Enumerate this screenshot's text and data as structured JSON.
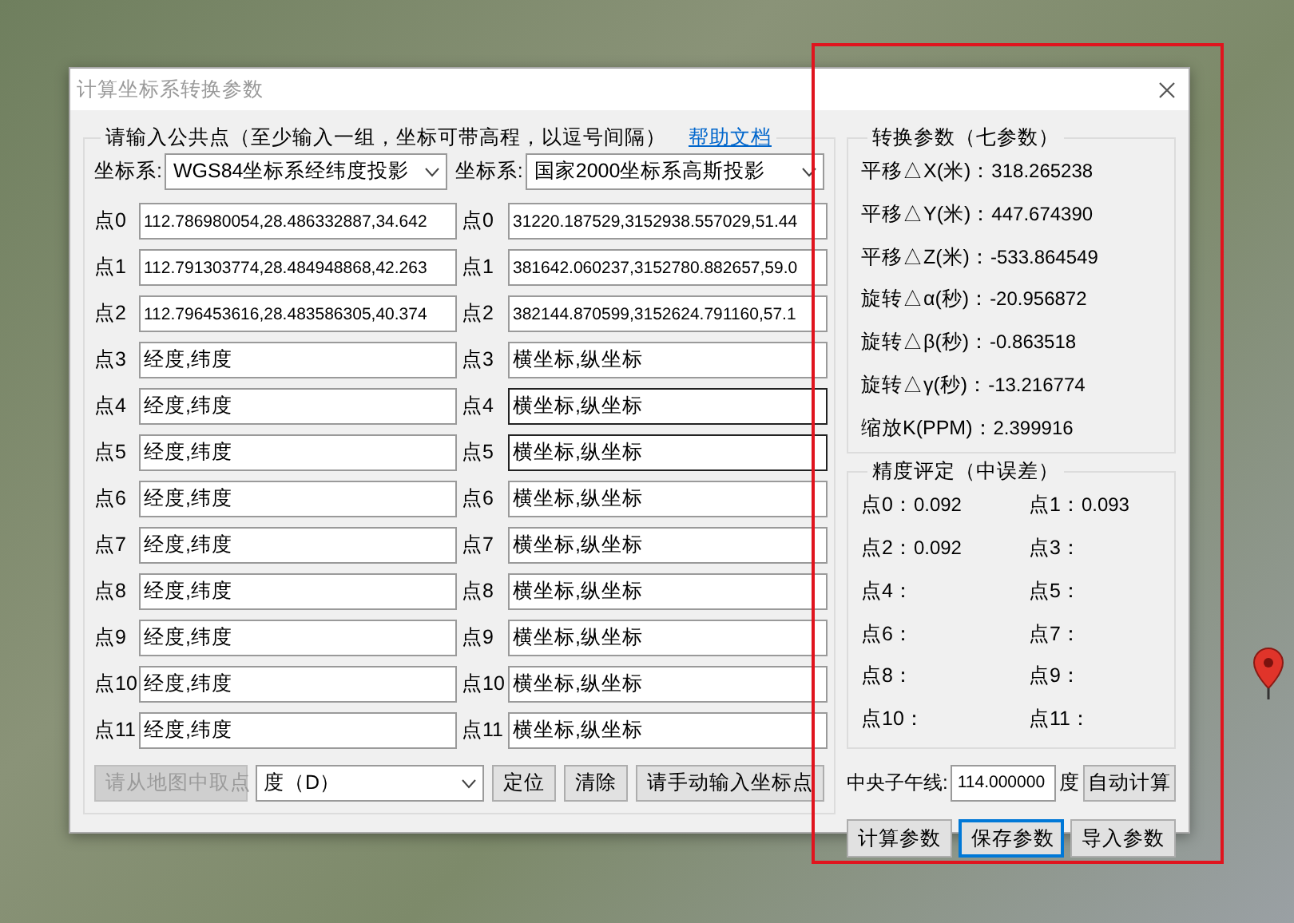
{
  "dialog": {
    "title": "计算坐标系转换参数"
  },
  "input_group": {
    "title": "请输入公共点（至少输入一组，坐标可带高程，以逗号间隔）",
    "help_link": "帮助文档",
    "source": {
      "label": "坐标系:",
      "value": "WGS84坐标系经纬度投影"
    },
    "target": {
      "label": "坐标系:",
      "value": "国家2000坐标系高斯投影"
    },
    "points": [
      {
        "label": "点0",
        "value": "112.786980054,28.486332887,34.642",
        "target_label": "点0",
        "target_value": "31220.187529,3152938.557029,51.44",
        "target_highlighted": false
      },
      {
        "label": "点1",
        "value": "112.791303774,28.484948868,42.263",
        "target_label": "点1",
        "target_value": "381642.060237,3152780.882657,59.0",
        "target_highlighted": false
      },
      {
        "label": "点2",
        "value": "112.796453616,28.483586305,40.374",
        "target_label": "点2",
        "target_value": "382144.870599,3152624.791160,57.1",
        "target_highlighted": false
      },
      {
        "label": "点3",
        "placeholder": "经度,纬度",
        "target_label": "点3",
        "target_placeholder": "横坐标,纵坐标",
        "target_highlighted": false
      },
      {
        "label": "点4",
        "placeholder": "经度,纬度",
        "target_label": "点4",
        "target_placeholder": "横坐标,纵坐标",
        "target_highlighted": true
      },
      {
        "label": "点5",
        "placeholder": "经度,纬度",
        "target_label": "点5",
        "target_placeholder": "横坐标,纵坐标",
        "target_highlighted": true
      },
      {
        "label": "点6",
        "placeholder": "经度,纬度",
        "target_label": "点6",
        "target_placeholder": "横坐标,纵坐标",
        "target_highlighted": false
      },
      {
        "label": "点7",
        "placeholder": "经度,纬度",
        "target_label": "点7",
        "target_placeholder": "横坐标,纵坐标",
        "target_highlighted": false
      },
      {
        "label": "点8",
        "placeholder": "经度,纬度",
        "target_label": "点8",
        "target_placeholder": "横坐标,纵坐标",
        "target_highlighted": false
      },
      {
        "label": "点9",
        "placeholder": "经度,纬度",
        "target_label": "点9",
        "target_placeholder": "横坐标,纵坐标",
        "target_highlighted": false
      },
      {
        "label": "点10",
        "placeholder": "经度,纬度",
        "target_label": "点10",
        "target_placeholder": "横坐标,纵坐标",
        "target_highlighted": false
      },
      {
        "label": "点11",
        "placeholder": "经度,纬度",
        "target_label": "点11",
        "target_placeholder": "横坐标,纵坐标",
        "target_highlighted": false
      }
    ]
  },
  "toolbar": {
    "pick_button": {
      "label": "请从地图中取点",
      "disabled": true
    },
    "unit_select": {
      "value": "度（D）"
    },
    "buttons": [
      "定位",
      "清除",
      "请手动输入坐标点"
    ]
  },
  "params_group": {
    "title": "转换参数（七参数）",
    "items": [
      {
        "label": "平移△X(米)：",
        "value": "318.265238"
      },
      {
        "label": "平移△Y(米)：",
        "value": "447.674390"
      },
      {
        "label": "平移△Z(米)：",
        "value": "-533.864549"
      },
      {
        "label": "旋转△α(秒)：",
        "value": "-20.956872"
      },
      {
        "label": "旋转△β(秒)：",
        "value": "-0.863518"
      },
      {
        "label": "旋转△γ(秒)：",
        "value": "-13.216774"
      },
      {
        "label": "缩放K(PPM)：",
        "value": "2.399916"
      }
    ]
  },
  "accuracy_group": {
    "title": "精度评定（中误差）",
    "items": [
      {
        "label": "点0：",
        "value": "0.092"
      },
      {
        "label": "点1：",
        "value": "0.093"
      },
      {
        "label": "点2：",
        "value": "0.092"
      },
      {
        "label": "点3："
      },
      {
        "label": "点4："
      },
      {
        "label": "点5："
      },
      {
        "label": "点6："
      },
      {
        "label": "点7："
      },
      {
        "label": "点8："
      },
      {
        "label": "点9："
      },
      {
        "label": "点10："
      },
      {
        "label": "点11："
      }
    ]
  },
  "meridian": {
    "label": "中央子午线:",
    "value": "114.000000",
    "unit": "度",
    "button": "自动计算"
  },
  "actions": [
    {
      "label": "计算参数",
      "focused": false
    },
    {
      "label": "保存参数",
      "focused": true
    },
    {
      "label": "导入参数",
      "focused": false
    }
  ]
}
